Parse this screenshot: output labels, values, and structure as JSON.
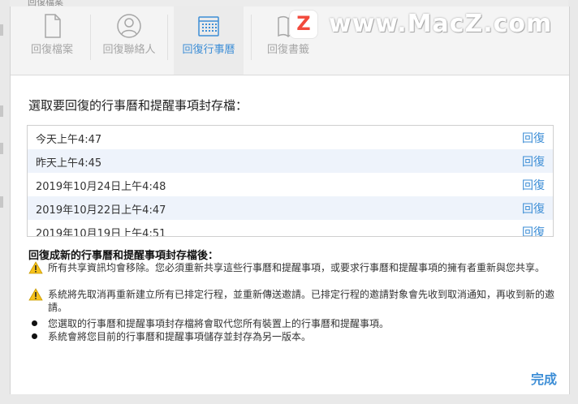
{
  "background": {
    "partial_text": "回復檔案"
  },
  "toolbar": {
    "tabs": [
      {
        "label": "回復檔案",
        "icon": "document-icon"
      },
      {
        "label": "回復聯絡人",
        "icon": "contact-icon"
      },
      {
        "label": "回復行事曆",
        "icon": "calendar-icon"
      },
      {
        "label": "回復書籤",
        "icon": "bookmark-icon"
      }
    ],
    "active_tab": "回復行事曆",
    "accent_color": "#3d8ed6"
  },
  "watermark": {
    "logo_letter": "Z",
    "text": "www.MacZ.com"
  },
  "main": {
    "prompt": "選取要回復的行事曆和提醒事項封存檔：",
    "archives": [
      {
        "date": "今天上午4:47",
        "action": "回復"
      },
      {
        "date": "昨天上午4:45",
        "action": "回復"
      },
      {
        "date": "2019年10月24日上午4:48",
        "action": "回復"
      },
      {
        "date": "2019年10月22日上午4:47",
        "action": "回復"
      },
      {
        "date": "2019年10月19日上午4:51",
        "action": "回復"
      }
    ],
    "after_title": "回復成新的行事曆和提醒事項封存檔後：",
    "notes": [
      {
        "type": "warning",
        "text": "所有共享資訊均會移除。您必須重新共享這些行事曆和提醒事項，或要求行事曆和提醒事項的擁有者重新與您共享。"
      },
      {
        "type": "warning",
        "text": "系統將先取消再重新建立所有已排定行程，並重新傳送邀請。已排定行程的邀請對象會先收到取消通知，再收到新的邀請。"
      },
      {
        "type": "bullet",
        "text": "您選取的行事曆和提醒事項封存檔將會取代您所有裝置上的行事曆和提醒事項。"
      },
      {
        "type": "bullet",
        "text": "系統會將您目前的行事曆和提醒事項儲存並封存為另一版本。"
      }
    ]
  },
  "footer": {
    "done_label": "完成"
  }
}
